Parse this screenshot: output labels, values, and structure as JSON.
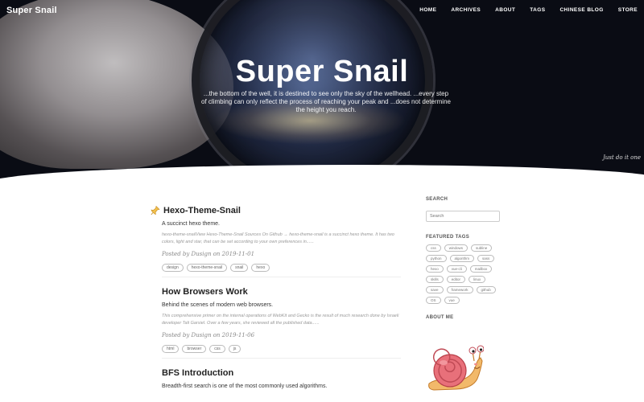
{
  "header": {
    "brand": "Super Snail",
    "nav": [
      "HOME",
      "ARCHIVES",
      "ABOUT",
      "TAGS",
      "CHINESE BLOG",
      "STORE"
    ],
    "title": "Super Snail",
    "subtitle": "...the bottom of the well, it is destined to see only the sky of the wellhead. ...every step of climbing can only reflect the process of reaching your peak and ...does not determine the height you reach.",
    "signature": "Just do it one"
  },
  "posts": [
    {
      "title": "Hexo-Theme-Snail",
      "subtitle": "A succinct hexo theme.",
      "excerpt": "hexo-theme-snailView Hexo-Theme-Snail Sources On Github → hexo-theme-snail is a succinct hexo theme. It has two colors, light and star, that can be set according to your own preferences in......",
      "meta": "Posted by Dusign on 2019-11-01",
      "tags": [
        "design",
        "hexo-theme-snail",
        "snail",
        "hexo"
      ]
    },
    {
      "title": "How Browsers Work",
      "subtitle": "Behind the scenes of modern web browsers.",
      "excerpt": "This comprehensive primer on the internal operations of WebKit and Gecko is the result of much research done by Israeli developer Tali Garsiel. Over a few years, she reviewed all the published data......",
      "meta": "Posted by Dusign on 2019-11-06",
      "tags": [
        "html",
        "browser",
        "css",
        "js"
      ]
    },
    {
      "title": "BFS Introduction",
      "subtitle": "Breadth-first search is one of the most commonly used algorithms.",
      "excerpt": "",
      "meta": "",
      "tags": []
    }
  ],
  "sidebar": {
    "search_heading": "SEARCH",
    "search_placeholder": "Search",
    "tags_heading": "FEATURED TAGS",
    "featured_tags": [
      "css",
      "windows",
      "subline",
      "python",
      "algorithm",
      "sass",
      "hexo",
      "vue-cli",
      "mailbox",
      "skills",
      "editor",
      "linux",
      "save",
      "framework",
      "github",
      "OS",
      "vue"
    ],
    "about_heading": "ABOUT ME"
  }
}
